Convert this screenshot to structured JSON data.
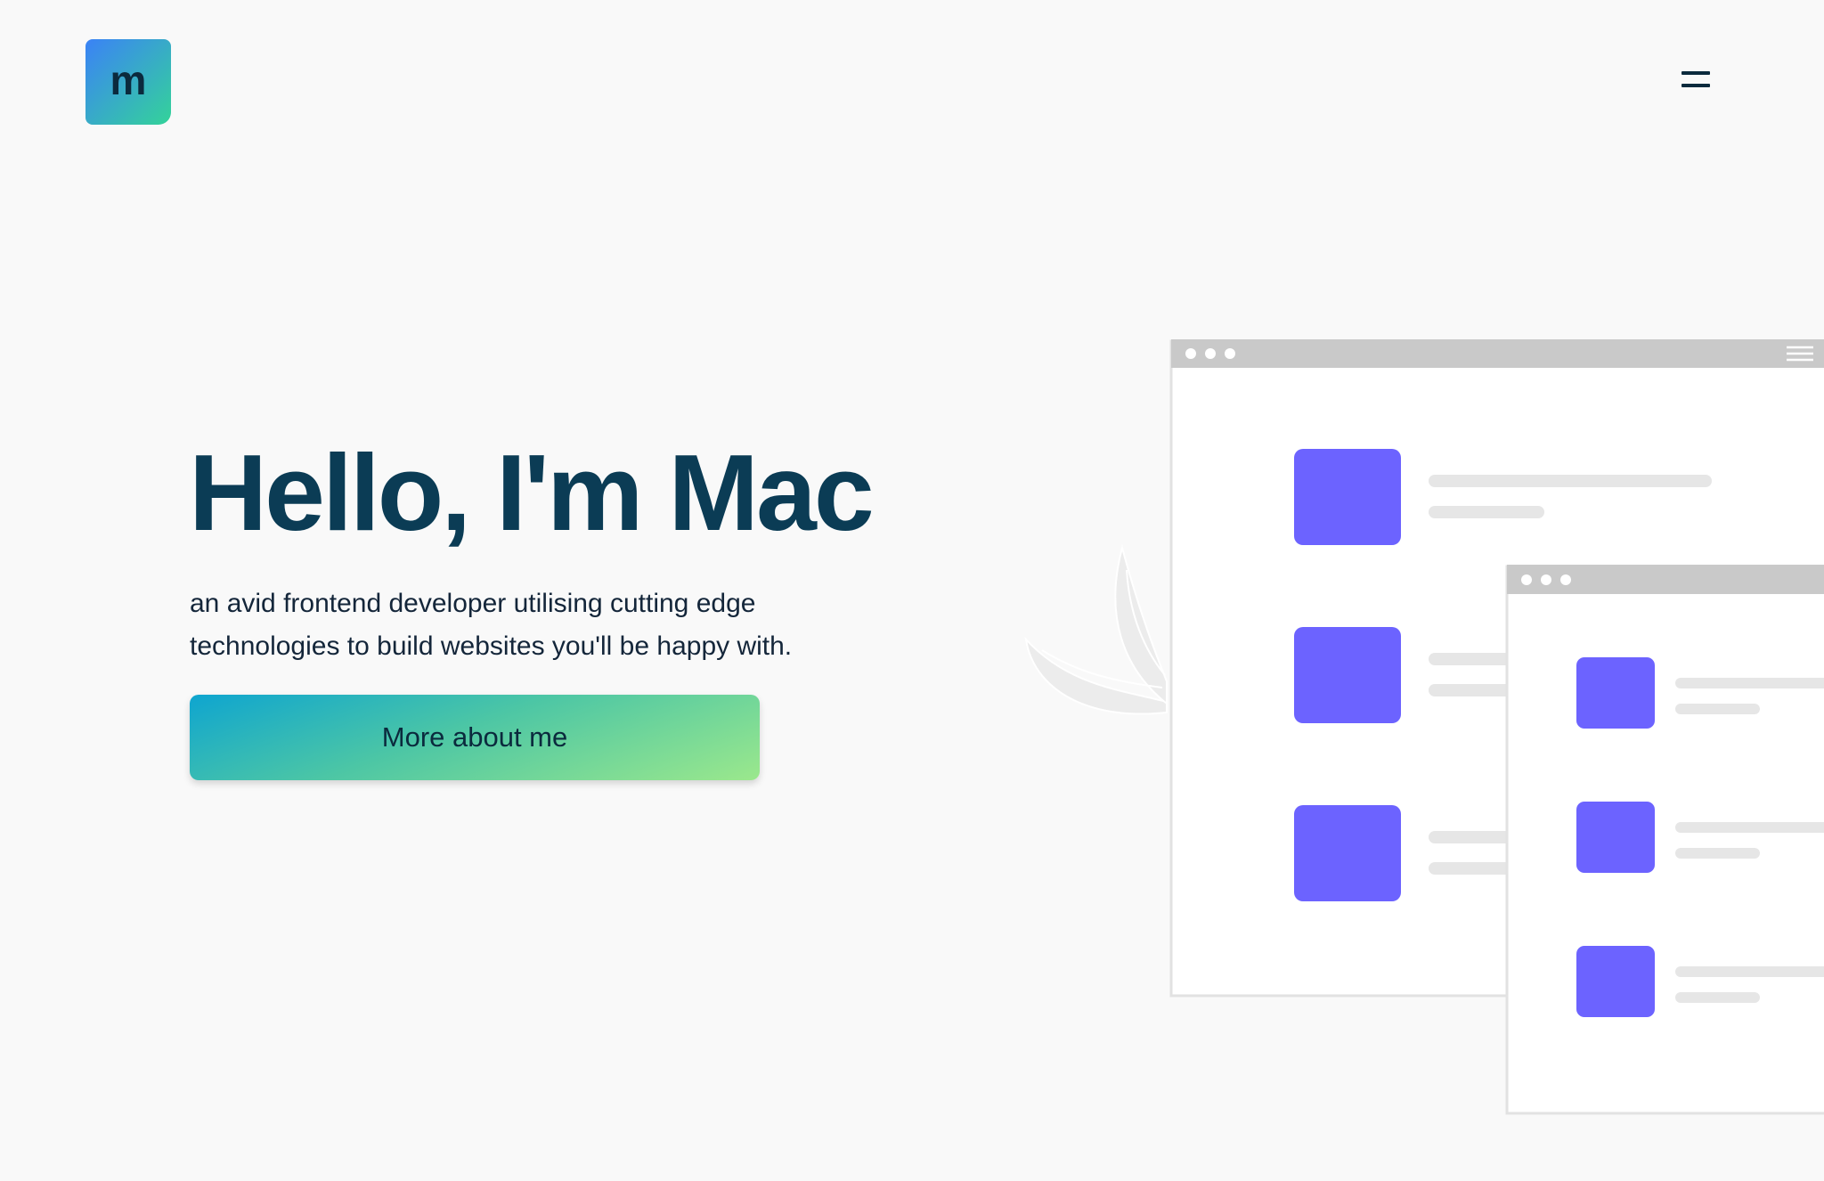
{
  "header": {
    "logo_letter": "m"
  },
  "hero": {
    "title": "Hello, I'm Mac",
    "subtitle": "an avid frontend developer utilising cutting edge technologies to build websites you'll be happy with.",
    "cta_label": "More about me"
  },
  "colors": {
    "accent": "#6c63ff",
    "title": "#0b3c55",
    "text": "#14263a",
    "background": "#f9f9f9",
    "window_bar": "#c9c9c9",
    "placeholder_line": "#e6e6e6"
  },
  "icons": {
    "menu": "hamburger-menu-icon",
    "leaf": "leaf-decoration-icon"
  }
}
